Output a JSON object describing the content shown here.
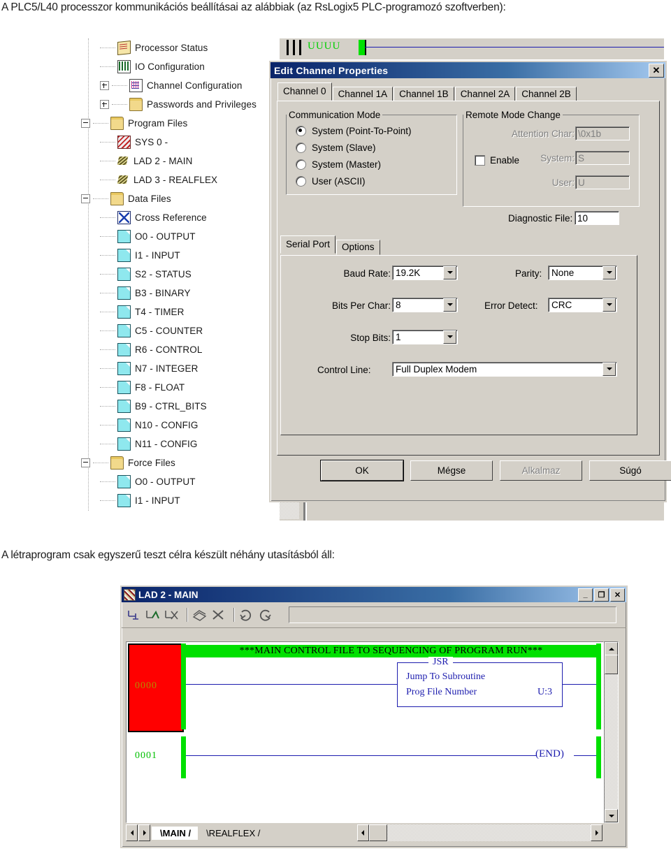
{
  "document": {
    "intro_text": "A PLC5/L40 processzor kommunikációs beállításai az alábbiak (az RsLogix5 PLC-programozó szoftverben):",
    "mid_text": "A létraprogram csak egyszerű teszt célra készült néhány utasításból áll:"
  },
  "tree": {
    "items": [
      {
        "label": "Processor Status",
        "icon": "status-icon",
        "indent": 2,
        "expander": "none"
      },
      {
        "label": "IO Configuration",
        "icon": "io-icon",
        "indent": 2,
        "expander": "none"
      },
      {
        "label": "Channel Configuration",
        "icon": "channel-icon",
        "indent": 2,
        "expander": "plus"
      },
      {
        "label": "Passwords and Privileges",
        "icon": "folder-icon",
        "indent": 2,
        "expander": "plus"
      },
      {
        "label": "Program Files",
        "icon": "folder-icon",
        "indent": 1,
        "expander": "minus"
      },
      {
        "label": "SYS 0 -",
        "icon": "sys-file-icon",
        "indent": 2,
        "expander": "none"
      },
      {
        "label": "LAD 2 - MAIN",
        "icon": "ladder-icon",
        "indent": 2,
        "expander": "none"
      },
      {
        "label": "LAD 3 - REALFLEX",
        "icon": "ladder-icon",
        "indent": 2,
        "expander": "none"
      },
      {
        "label": "Data Files",
        "icon": "folder-icon",
        "indent": 1,
        "expander": "minus"
      },
      {
        "label": "Cross Reference",
        "icon": "xref-icon",
        "indent": 2,
        "expander": "none"
      },
      {
        "label": "O0 - OUTPUT",
        "icon": "data-file-icon",
        "indent": 2,
        "expander": "none"
      },
      {
        "label": "I1 - INPUT",
        "icon": "data-file-icon",
        "indent": 2,
        "expander": "none"
      },
      {
        "label": "S2 - STATUS",
        "icon": "data-file-icon",
        "indent": 2,
        "expander": "none"
      },
      {
        "label": "B3 - BINARY",
        "icon": "data-file-icon",
        "indent": 2,
        "expander": "none"
      },
      {
        "label": "T4 - TIMER",
        "icon": "data-file-icon",
        "indent": 2,
        "expander": "none"
      },
      {
        "label": "C5 - COUNTER",
        "icon": "data-file-icon",
        "indent": 2,
        "expander": "none"
      },
      {
        "label": "R6 - CONTROL",
        "icon": "data-file-icon",
        "indent": 2,
        "expander": "none"
      },
      {
        "label": "N7 - INTEGER",
        "icon": "data-file-icon",
        "indent": 2,
        "expander": "none"
      },
      {
        "label": "F8 - FLOAT",
        "icon": "data-file-icon",
        "indent": 2,
        "expander": "none"
      },
      {
        "label": "B9 - CTRL_BITS",
        "icon": "data-file-icon",
        "indent": 2,
        "expander": "none"
      },
      {
        "label": "N10 - CONFIG",
        "icon": "data-file-icon",
        "indent": 2,
        "expander": "none"
      },
      {
        "label": "N11 - CONFIG",
        "icon": "data-file-icon",
        "indent": 2,
        "expander": "none"
      },
      {
        "label": "Force Files",
        "icon": "folder-icon",
        "indent": 1,
        "expander": "minus"
      },
      {
        "label": "O0 - OUTPUT",
        "icon": "data-file-icon",
        "indent": 2,
        "expander": "none"
      },
      {
        "label": "I1 - INPUT",
        "icon": "data-file-icon",
        "indent": 2,
        "expander": "none"
      }
    ]
  },
  "dialog": {
    "title": "Edit Channel Properties",
    "close_label": "✕",
    "channel_tabs": [
      {
        "label": "Channel 0",
        "selected": true
      },
      {
        "label": "Channel 1A",
        "selected": false
      },
      {
        "label": "Channel 1B",
        "selected": false
      },
      {
        "label": "Channel 2A",
        "selected": false
      },
      {
        "label": "Channel 2B",
        "selected": false
      }
    ],
    "communication_mode": {
      "legend": "Communication Mode",
      "options": [
        {
          "label": "System (Point-To-Point)",
          "selected": true
        },
        {
          "label": "System (Slave)",
          "selected": false
        },
        {
          "label": "System (Master)",
          "selected": false
        },
        {
          "label": "User (ASCII)",
          "selected": false
        }
      ]
    },
    "remote_mode_change": {
      "legend": "Remote Mode Change",
      "enable_label": "Enable",
      "enable_checked": false,
      "attention_char_label": "Attention Char:",
      "attention_char_value": "\\0x1b",
      "system_label": "System:",
      "system_value": "S",
      "user_label": "User:",
      "user_value": "U"
    },
    "diagnostic_file": {
      "label": "Diagnostic File:",
      "value": "10"
    },
    "inner_tabs": [
      {
        "label": "Serial Port",
        "selected": true
      },
      {
        "label": "Options",
        "selected": false
      }
    ],
    "serial_port": {
      "baud_rate": {
        "label": "Baud Rate:",
        "value": "19.2K"
      },
      "bits_per_char": {
        "label": "Bits Per Char:",
        "value": "8"
      },
      "stop_bits": {
        "label": "Stop Bits:",
        "value": "1"
      },
      "parity": {
        "label": "Parity:",
        "value": "None"
      },
      "error_detect": {
        "label": "Error Detect:",
        "value": "CRC"
      },
      "control_line": {
        "label": "Control Line:",
        "value": "Full Duplex Modem"
      }
    },
    "buttons": [
      {
        "label": "OK",
        "state": "default"
      },
      {
        "label": "Mégse",
        "state": "enabled"
      },
      {
        "label": "Alkalmaz",
        "state": "disabled"
      },
      {
        "label": "Súgó",
        "state": "enabled"
      }
    ]
  },
  "ladder_window": {
    "title": "LAD 2 - MAIN",
    "window_buttons": [
      {
        "name": "minimize",
        "glyph": "_"
      },
      {
        "name": "maximize",
        "glyph": "❐"
      },
      {
        "name": "close",
        "glyph": "✕"
      }
    ],
    "address_value": "",
    "rungs": [
      {
        "number": "0000",
        "comment": "***MAIN CONTROL FILE TO SEQUENCING OF  PROGRAM RUN***",
        "instruction": {
          "mnemonic": "JSR",
          "title": "Jump To Subroutine",
          "operand_label": "Prog File Number",
          "operand_value": "U:3"
        }
      },
      {
        "number": "0001",
        "end_label": "END"
      }
    ],
    "sheet_tabs": [
      {
        "label": "MAIN",
        "selected": true
      },
      {
        "label": "REALFLEX",
        "selected": false
      }
    ]
  },
  "colors": {
    "title_bar_start": "#0a246a",
    "title_bar_end": "#a6caf0",
    "dialog_face": "#d4d0c8",
    "rail_green": "#00e000",
    "wire_blue": "#1c1cae",
    "rung_select_red": "#ff0000",
    "rung_number_green": "#00d000"
  }
}
